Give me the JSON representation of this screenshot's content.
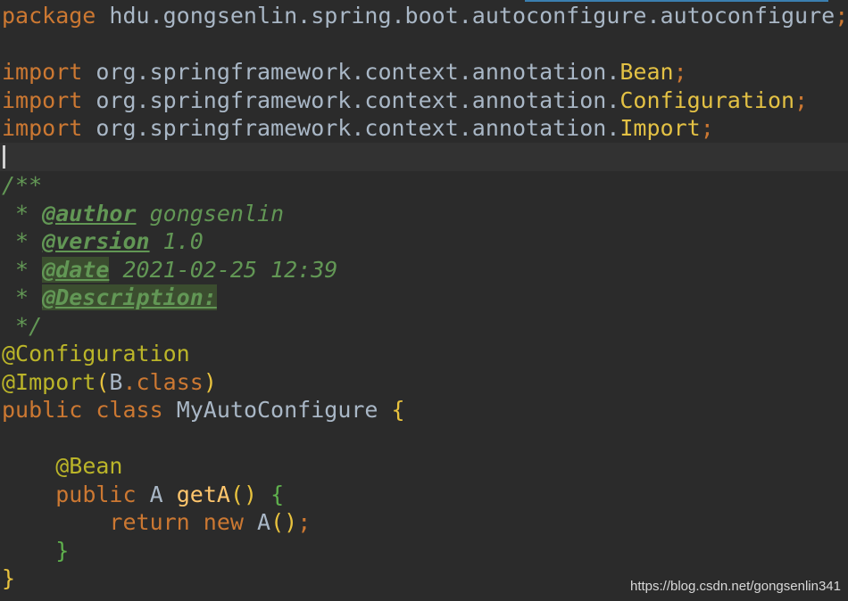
{
  "code": {
    "package_kw": "package",
    "package_name": "hdu.gongsenlin.spring.boot.autoconfigure.autoconfigure",
    "semicolon": ";",
    "import_kw": "import",
    "import_path": "org.springframework.context.annotation.",
    "imports": [
      "Bean",
      "Configuration",
      "Import"
    ],
    "doc_open": "/**",
    "doc_star": " * ",
    "doc_close": " */",
    "author_tag": "@author",
    "author_value": " gongsenlin",
    "version_tag": "@version",
    "version_value": " 1.0",
    "date_tag": "@date",
    "date_value": " 2021-02-25 12:39",
    "description_tag": "@Description:",
    "annotation_configuration": "@Configuration",
    "annotation_import": "@Import",
    "import_arg_open": "(",
    "import_arg_class": "B",
    "dot": ".",
    "class_kw": "class",
    "import_arg_close": ")",
    "public_kw": "public",
    "class_name": "MyAutoConfigure",
    "brace_open": "{",
    "brace_close": "}",
    "annotation_bean": "@Bean",
    "method_return_type": "A",
    "method_name": "getA",
    "method_parens": "()",
    "return_kw": "return",
    "new_kw": "new",
    "new_type": "A",
    "call_parens": "()"
  },
  "watermark": "https://blog.csdn.net/gongsenlin341",
  "colors": {
    "background": "#2b2b2b",
    "keyword": "#cc7832",
    "plain": "#a9b7c6",
    "annotation": "#bbb529",
    "javadoc": "#629755",
    "method": "#ffc66d"
  }
}
